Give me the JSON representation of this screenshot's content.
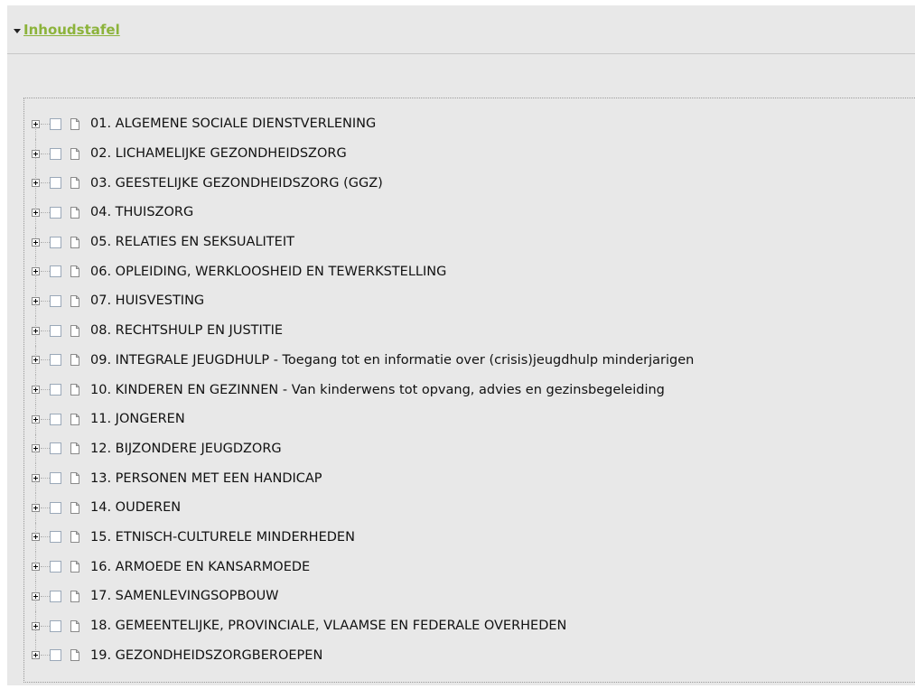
{
  "header": {
    "title": "Inhoudstafel"
  },
  "tree": {
    "items": [
      {
        "label": "01. ALGEMENE SOCIALE DIENSTVERLENING"
      },
      {
        "label": "02. LICHAMELIJKE GEZONDHEIDSZORG"
      },
      {
        "label": "03. GEESTELIJKE GEZONDHEIDSZORG (GGZ)"
      },
      {
        "label": "04. THUISZORG"
      },
      {
        "label": "05. RELATIES EN SEKSUALITEIT"
      },
      {
        "label": "06. OPLEIDING, WERKLOOSHEID EN TEWERKSTELLING"
      },
      {
        "label": "07. HUISVESTING"
      },
      {
        "label": "08. RECHTSHULP EN JUSTITIE"
      },
      {
        "label": "09. INTEGRALE JEUGDHULP - Toegang tot en informatie over (crisis)jeugdhulp minderjarigen"
      },
      {
        "label": "10. KINDEREN EN GEZINNEN - Van kinderwens tot opvang, advies en gezinsbegeleiding"
      },
      {
        "label": "11. JONGEREN"
      },
      {
        "label": "12. BIJZONDERE JEUGDZORG"
      },
      {
        "label": "13. PERSONEN MET EEN HANDICAP"
      },
      {
        "label": "14. OUDEREN"
      },
      {
        "label": "15. ETNISCH-CULTURELE MINDERHEDEN"
      },
      {
        "label": "16. ARMOEDE EN KANSARMOEDE"
      },
      {
        "label": "17. SAMENLEVINGSOPBOUW"
      },
      {
        "label": "18. GEMEENTELIJKE, PROVINCIALE, VLAAMSE EN FEDERALE OVERHEDEN"
      },
      {
        "label": "19. GEZONDHEIDSZORGBEROEPEN"
      }
    ]
  },
  "icons": {
    "collapse": "caret-down-icon",
    "expand": "plus-box-icon",
    "checkbox": "checkbox-icon",
    "document": "document-icon"
  },
  "colors": {
    "link": "#8cb33b",
    "panel_bg": "#e8e8e8"
  }
}
